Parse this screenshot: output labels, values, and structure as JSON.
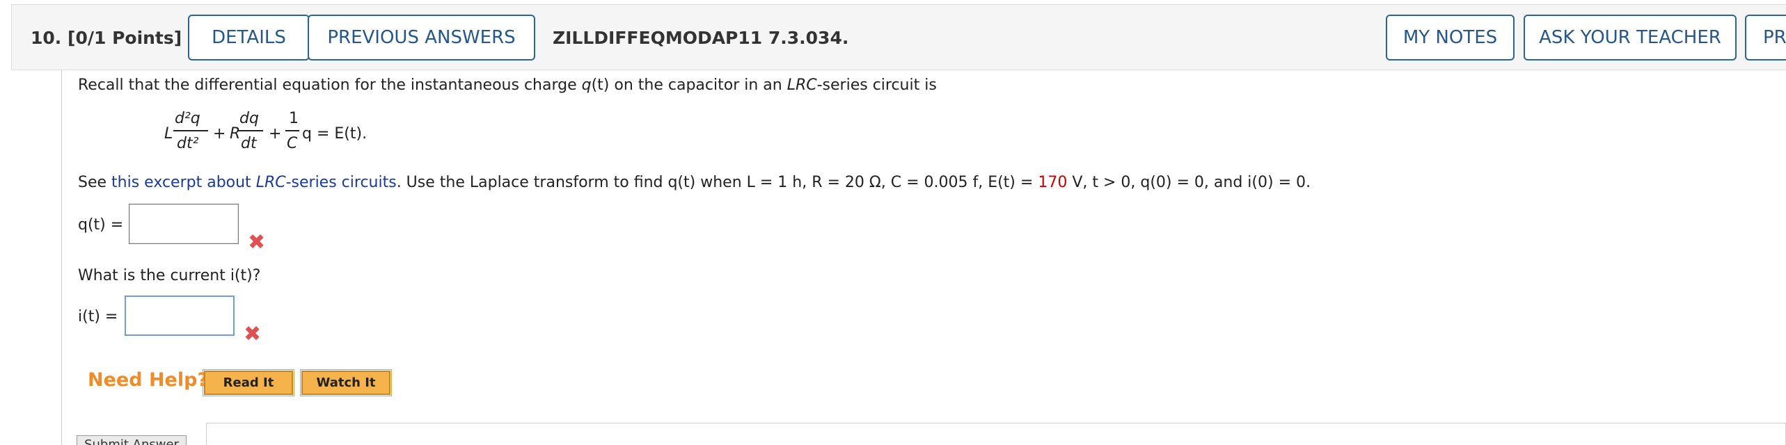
{
  "header": {
    "question_number": "10.",
    "points": "[0/1 Points]",
    "details_label": "DETAILS",
    "previous_answers_label": "PREVIOUS ANSWERS",
    "question_code": "ZILLDIFFEQMODAP11 7.3.034.",
    "my_notes_label": "MY NOTES",
    "ask_teacher_label": "ASK YOUR TEACHER",
    "practice_label": "PRA"
  },
  "intro": {
    "part1": "Recall that the differential equation for the instantaneous charge ",
    "q_of_t": "q",
    "part2": "(t) on the capacitor in an ",
    "lrc": "LRC",
    "part3": "-series circuit is"
  },
  "equation": {
    "L": "L",
    "num1": "d²q",
    "den1": "dt²",
    "plus1": "+",
    "R": "R",
    "num2": "dq",
    "den2": "dt",
    "plus2": "+",
    "num3": "1",
    "den3": "C",
    "rhs": "q = E(t)."
  },
  "problem": {
    "see": "See ",
    "link_text_1": "this excerpt about ",
    "link_text_lrc": "LRC",
    "link_text_2": "-series circuits",
    "after_link": ". Use the Laplace transform to find q(t) when L = 1 h, R = 20 Ω, C = 0.005 f, E(t) = ",
    "voltage_value": "170",
    "tail": " V, t > 0, q(0) = 0, and i(0) = 0."
  },
  "answers": {
    "q_label": "q(t) =",
    "q_value": "",
    "current_question": "What is the current i(t)?",
    "i_label": "i(t) =",
    "i_value": ""
  },
  "help": {
    "label": "Need Help?",
    "read_it": "Read It",
    "watch_it": "Watch It"
  },
  "submit_label": "Submit Answer",
  "colors": {
    "button_text": "#25578a",
    "incorrect_mark": "#e05050",
    "need_help": "#f08c28",
    "help_button": "#f6b24b",
    "highlight_value": "#cc0000",
    "link": "#1a3aa0"
  }
}
